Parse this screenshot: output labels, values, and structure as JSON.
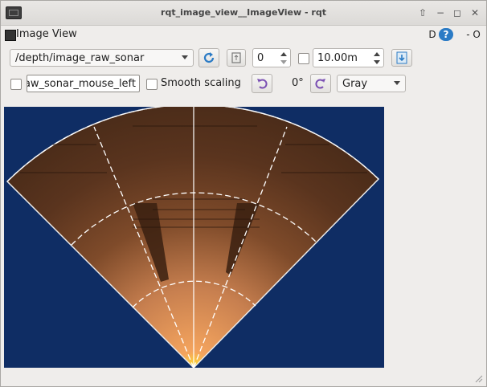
{
  "window": {
    "title": "rqt_image_view__ImageView - rqt"
  },
  "dock": {
    "title": "Image View",
    "help_label": "D",
    "close_label": "- O"
  },
  "toolbar": {
    "topic": "/depth/image_raw_sonar",
    "spin_value": "0",
    "max_range": "10.00m",
    "mouse_topic": "aw_sonar_mouse_left",
    "smooth_scaling_label": "Smooth scaling",
    "rotation": "0°",
    "colormap": "Gray"
  },
  "icons": [
    "window-icon",
    "refresh-icon",
    "zoom-fit-icon",
    "save-icon",
    "rotate-left-icon",
    "rotate-right-icon",
    "help-icon",
    "grip-icon"
  ],
  "colors": {
    "image_bg": "#0f2d64",
    "accent": "#2b7bc5"
  }
}
